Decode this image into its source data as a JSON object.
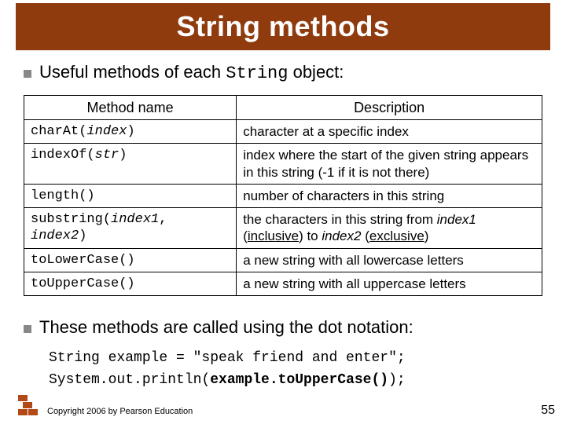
{
  "title": "String methods",
  "bullets": {
    "intro_pre": "Useful methods of each ",
    "intro_code": "String",
    "intro_post": " object:",
    "outro": "These methods are called using the dot notation:"
  },
  "table": {
    "headers": {
      "method": "Method name",
      "desc": "Description"
    },
    "rows": [
      {
        "m_pre": "charAt(",
        "m_args": "index",
        "m_post": ")",
        "d_html": "character at a specific index"
      },
      {
        "m_pre": "indexOf(",
        "m_args": "str",
        "m_post": ")",
        "d_html": "index where the start of the given string appears in this string (-1 if it is not there)"
      },
      {
        "m_pre": "length()",
        "m_args": "",
        "m_post": "",
        "d_html": "number of characters in this string"
      },
      {
        "m_pre": "substring(",
        "m_args": "index1",
        "m_mid": ", ",
        "m_args2": "index2",
        "m_post": ")",
        "d_html": "the characters in this string from <span class=\"ital\">index1</span> (<span class=\"ul\">inclusive</span>) to <span class=\"ital\">index2</span> (<span class=\"ul\">exclusive</span>)"
      },
      {
        "m_pre": "toLowerCase()",
        "m_args": "",
        "m_post": "",
        "d_html": "a new string with all lowercase letters"
      },
      {
        "m_pre": "toUpperCase()",
        "m_args": "",
        "m_post": "",
        "d_html": "a new string with all uppercase letters"
      }
    ]
  },
  "code": {
    "line1": "String example = \"speak friend and enter\";",
    "line2_pre": "System.out.println(",
    "line2_bold": "example.toUpperCase()",
    "line2_post": ");"
  },
  "footer": {
    "copyright": "Copyright 2006 by Pearson Education",
    "page": "55"
  }
}
